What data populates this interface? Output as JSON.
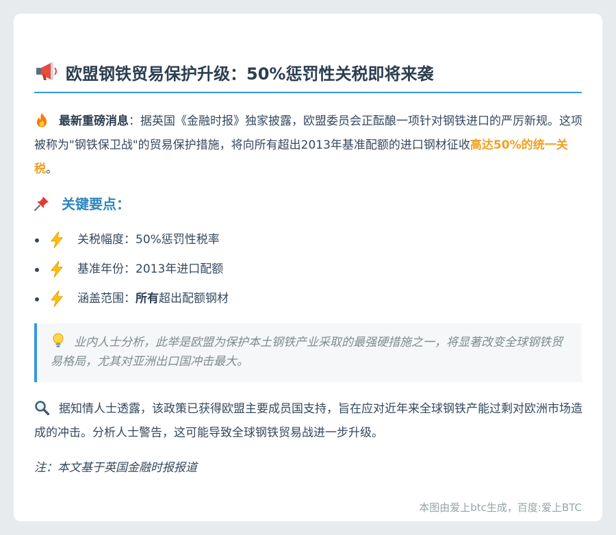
{
  "title": {
    "icon": "megaphone-icon",
    "text": "欧盟钢铁贸易保护升级：50%惩罚性关税即将来袭"
  },
  "intro": {
    "icon": "fire-icon",
    "lead": "最新重磅消息",
    "text_before": "：据英国《金融时报》独家披露，欧盟委员会正酝酿一项针对钢铁进口的严厉新规。这项被称为\"钢铁保卫战\"的贸易保护措施，将向所有超出2013年基准配额的进口钢材征收",
    "highlight": "高达50%的统一关税",
    "text_after": "。"
  },
  "key_points": {
    "icon": "pushpin-icon",
    "heading": "关键要点：",
    "items": [
      {
        "icon": "lightning-icon",
        "label": "关税幅度：",
        "bold": "",
        "value": "50%惩罚性税率"
      },
      {
        "icon": "lightning-icon",
        "label": "基准年份：",
        "bold": "",
        "value": "2013年进口配额"
      },
      {
        "icon": "lightning-icon",
        "label": "涵盖范围：",
        "bold": "所有",
        "value": "超出配额钢材"
      }
    ]
  },
  "quote": {
    "icon": "lightbulb-icon",
    "text": "业内人士分析，此举是欧盟为保护本土钢铁产业采取的最强硬措施之一，将显著改变全球钢铁贸易格局，尤其对亚洲出口国冲击最大。"
  },
  "analysis": {
    "icon": "magnifier-icon",
    "text": "据知情人士透露，该政策已获得欧盟主要成员国支持，旨在应对近年来全球钢铁产能过剩对欧洲市场造成的冲击。分析人士警告，这可能导致全球钢铁贸易战进一步升级。"
  },
  "note": "注：本文基于英国金融时报报道",
  "footer": "本图由爱上btc生成，百度:爱上BTC",
  "colors": {
    "accent": "#3498db",
    "heading_blue": "#2e86c1",
    "highlight": "#f0a01e",
    "text": "#34495e",
    "muted": "#95a5a6"
  }
}
